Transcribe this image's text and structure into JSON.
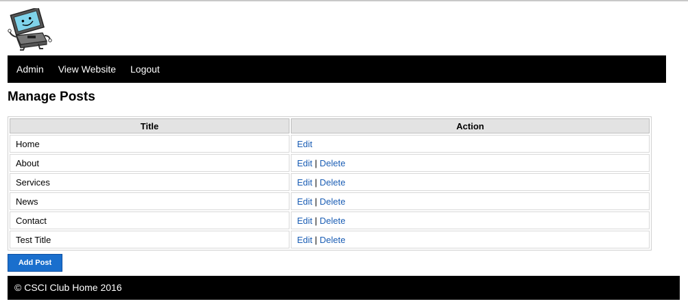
{
  "nav": {
    "items": [
      {
        "label": "Admin"
      },
      {
        "label": "View Website"
      },
      {
        "label": "Logout"
      }
    ]
  },
  "page": {
    "title": "Manage Posts"
  },
  "table": {
    "headers": {
      "title": "Title",
      "action": "Action"
    },
    "rows": [
      {
        "title": "Home",
        "edit": "Edit",
        "separator": "",
        "delete": ""
      },
      {
        "title": "About",
        "edit": "Edit",
        "separator": "|",
        "delete": "Delete"
      },
      {
        "title": "Services",
        "edit": "Edit",
        "separator": "|",
        "delete": "Delete"
      },
      {
        "title": "News",
        "edit": "Edit",
        "separator": "|",
        "delete": "Delete"
      },
      {
        "title": "Contact",
        "edit": "Edit",
        "separator": "|",
        "delete": "Delete"
      },
      {
        "title": "Test Title",
        "edit": "Edit",
        "separator": "|",
        "delete": "Delete"
      }
    ]
  },
  "buttons": {
    "add_post": "Add Post"
  },
  "footer": {
    "text": "© CSCI Club Home 2016"
  },
  "colors": {
    "nav_bg": "#000000",
    "link": "#1a5db4",
    "button": "#1a6fcd",
    "header_bg": "#e3e3e3"
  },
  "icons": {
    "logo": "computer-mascot-icon"
  }
}
